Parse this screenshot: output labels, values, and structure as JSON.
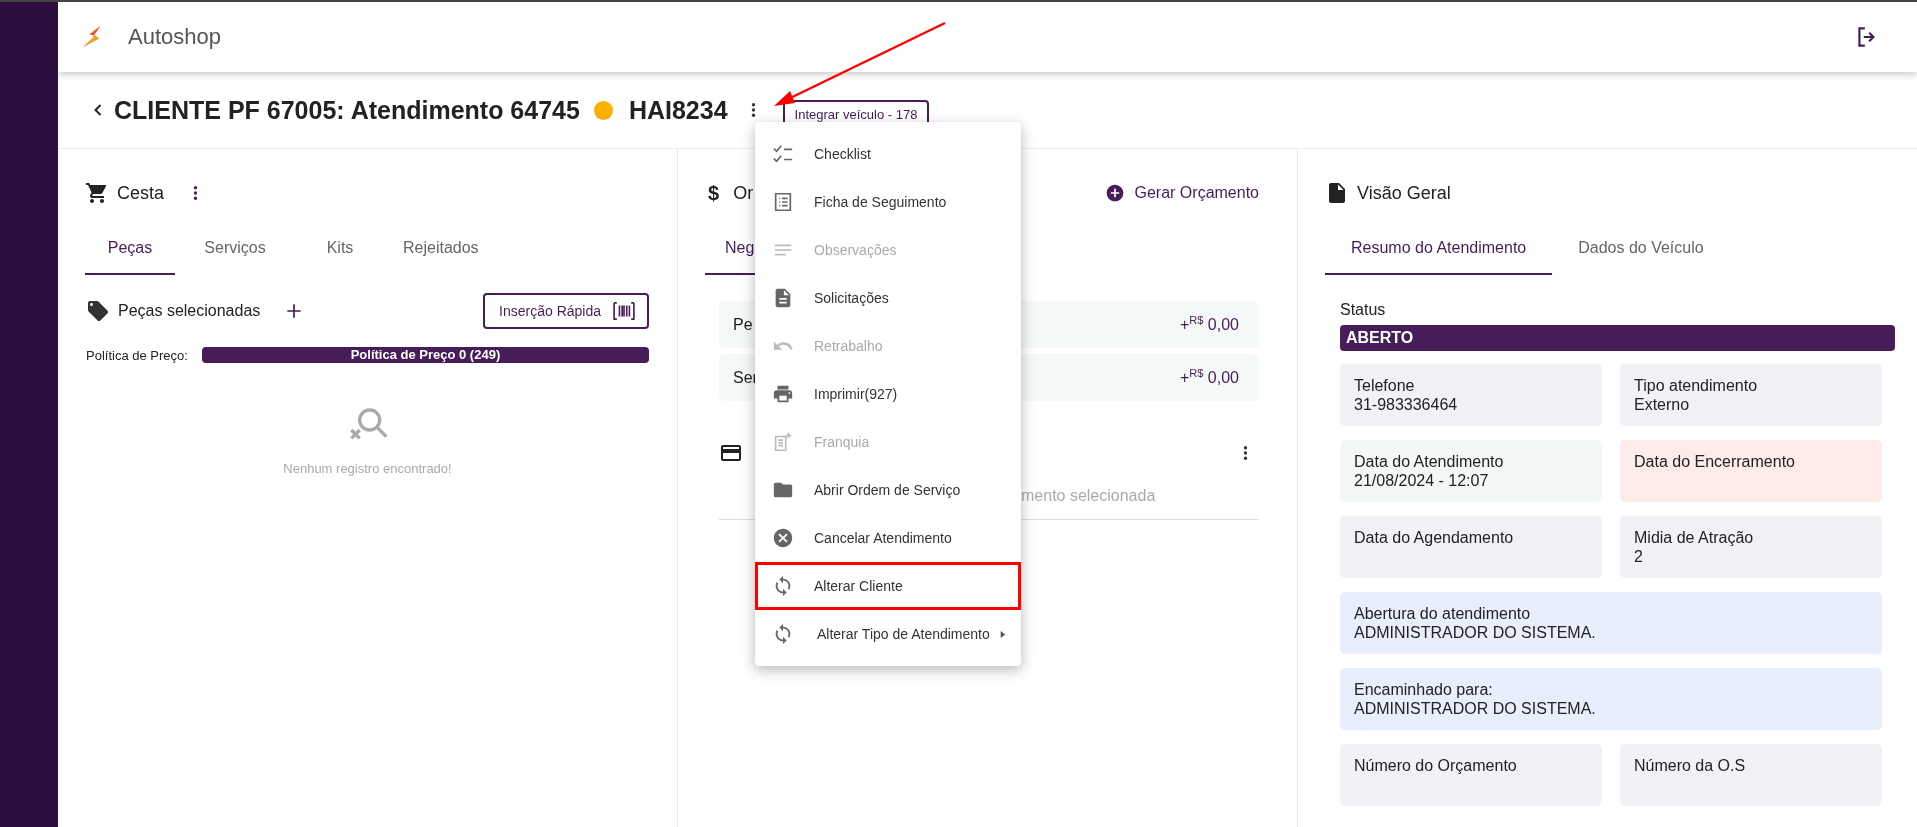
{
  "app": {
    "name": "Autoshop"
  },
  "header": {
    "title": "CLIENTE PF 67005: Atendimento 64745",
    "plate": "HAI8234",
    "integrate_button": "Integrar veículo - 178"
  },
  "menu": {
    "items": [
      {
        "label": "Checklist",
        "disabled": false,
        "highlighted": false,
        "submenu": false
      },
      {
        "label": "Ficha de Seguimento",
        "disabled": false,
        "highlighted": false,
        "submenu": false
      },
      {
        "label": "Observações",
        "disabled": true,
        "highlighted": false,
        "submenu": false
      },
      {
        "label": "Solicitações",
        "disabled": false,
        "highlighted": false,
        "submenu": false
      },
      {
        "label": "Retrabalho",
        "disabled": true,
        "highlighted": false,
        "submenu": false
      },
      {
        "label": "Imprimir(927)",
        "disabled": false,
        "highlighted": false,
        "submenu": false
      },
      {
        "label": "Franquia",
        "disabled": true,
        "highlighted": false,
        "submenu": false
      },
      {
        "label": "Abrir Ordem de Serviço",
        "disabled": false,
        "highlighted": false,
        "submenu": false
      },
      {
        "label": "Cancelar Atendimento",
        "disabled": false,
        "highlighted": false,
        "submenu": false
      },
      {
        "label": "Alterar Cliente",
        "disabled": false,
        "highlighted": true,
        "submenu": false
      },
      {
        "label": "Alterar Tipo de Atendimento",
        "disabled": false,
        "highlighted": false,
        "submenu": true
      }
    ]
  },
  "basket": {
    "title": "Cesta",
    "tabs": [
      {
        "label": "Peças",
        "selected": true
      },
      {
        "label": "Serviços",
        "selected": false
      },
      {
        "label": "Kits",
        "selected": false
      },
      {
        "label": "Rejeitados",
        "selected": false
      }
    ],
    "section_title": "Peças selecionadas",
    "quick_insert_button": "Inserção Rápida",
    "price_policy_label": "Política de Preço:",
    "price_policy_value": "Política de Preço 0 (249)",
    "empty_text": "Nenhum registro encontrado!"
  },
  "budget": {
    "icon": "$",
    "title": "Or",
    "action": "Gerar Orçamento",
    "tabs": [
      {
        "label": "Neg",
        "selected": true
      }
    ],
    "totals": [
      {
        "label": "Pe",
        "sign": "+",
        "currency": "R$",
        "amount": "0,00"
      },
      {
        "label": "Ser",
        "sign": "+",
        "currency": "R$",
        "amount": "0,00"
      }
    ],
    "payment_hint": "mento selecionada"
  },
  "overview": {
    "title": "Visão Geral",
    "tabs": [
      {
        "label": "Resumo do Atendimento",
        "selected": true
      },
      {
        "label": "Dados do Veículo",
        "selected": false
      }
    ],
    "status_label": "Status",
    "status": "ABERTO",
    "cards": [
      {
        "label": "Telefone",
        "value": "31-983336464",
        "kind": "half",
        "color": "#f2f2f6"
      },
      {
        "label": "Tipo atendimento",
        "value": "Externo",
        "kind": "half",
        "color": "#f2f2f6"
      },
      {
        "label": "Data do Atendimento",
        "value": "21/08/2024 - 12:07",
        "kind": "half",
        "color": "#f3f8f6"
      },
      {
        "label": "Data do Encerramento",
        "kind": "half",
        "color": "#fdecea"
      },
      {
        "label": "Data do Agendamento",
        "kind": "half",
        "color": "#f2f2f6"
      },
      {
        "label": "Midia de Atração",
        "value": "2",
        "kind": "half",
        "color": "#f2f2f6"
      },
      {
        "label": "Abertura do atendimento",
        "value": "ADMINISTRADOR DO SISTEMA.",
        "kind": "wide",
        "color": "#e9eefc"
      },
      {
        "label": "Encaminhado para:",
        "value": "ADMINISTRADOR DO SISTEMA.",
        "kind": "wide",
        "color": "#e9eefc"
      },
      {
        "label": "Número do Orçamento",
        "kind": "half",
        "color": "#f2f2f6"
      },
      {
        "label": "Número da O.S",
        "kind": "half",
        "color": "#f2f2f6"
      }
    ]
  }
}
